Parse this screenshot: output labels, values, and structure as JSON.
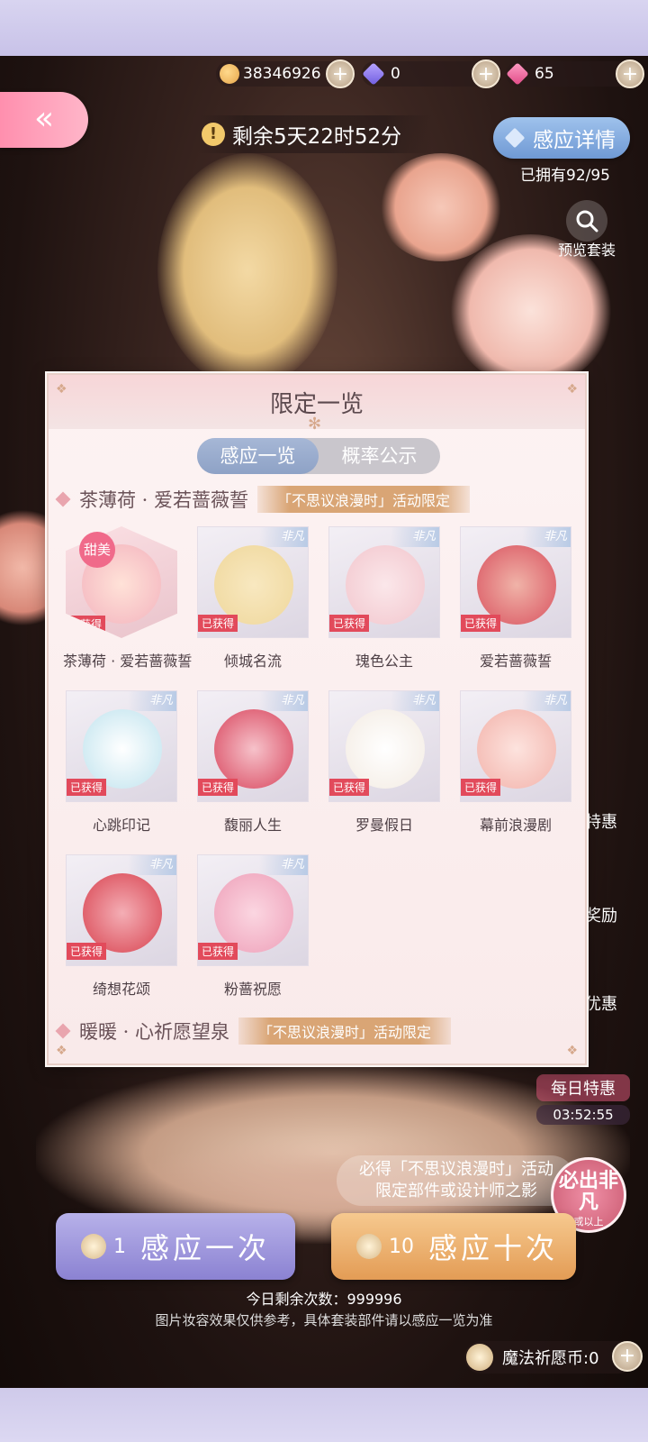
{
  "currency": {
    "coins": "38346926",
    "crystals": "0",
    "diamonds": "65",
    "coin_icon": "cat-coin-icon",
    "crystal_icon": "purple-diamond-icon",
    "diamond_icon": "pink-diamond-icon"
  },
  "back": {
    "label": "«"
  },
  "timer": {
    "text": "剩余5天22时52分"
  },
  "detail": {
    "label": "感应详情",
    "owned": "已拥有92/95"
  },
  "preview": {
    "label": "预览套装"
  },
  "side": {
    "deal": "特惠",
    "reward": "奖励",
    "benefit": "优惠"
  },
  "daily": {
    "title": "每日特惠",
    "time": "03:52:55"
  },
  "panel": {
    "title": "限定一览",
    "tabs": [
      {
        "label": "感应一览",
        "active": true
      },
      {
        "label": "概率公示",
        "active": false
      }
    ],
    "sets": [
      {
        "name": "茶薄荷 · 爱若蔷薇誓",
        "tag": "「不思议浪漫时」活动限定",
        "items": [
          {
            "name": "茶薄荷 · 爱若蔷薇誓",
            "status": "已获得",
            "badge": "甜美",
            "color": "#f3b3be"
          },
          {
            "name": "倾城名流",
            "status": "已获得",
            "ribbon": "非凡",
            "color": "#efd79b"
          },
          {
            "name": "瑰色公主",
            "status": "已获得",
            "ribbon": "非凡",
            "color": "#f2c6cd"
          },
          {
            "name": "爱若蔷薇誓",
            "status": "已获得",
            "ribbon": "非凡",
            "color": "#d9525f"
          },
          {
            "name": "心跳印记",
            "status": "已获得",
            "ribbon": "非凡",
            "color": "#bfe3ee"
          },
          {
            "name": "馥丽人生",
            "status": "已获得",
            "ribbon": "非凡",
            "color": "#d8445c"
          },
          {
            "name": "罗曼假日",
            "status": "已获得",
            "ribbon": "非凡",
            "color": "#f3ebe2"
          },
          {
            "name": "幕前浪漫剧",
            "status": "已获得",
            "ribbon": "非凡",
            "color": "#f2b2aa"
          },
          {
            "name": "绮想花颂",
            "status": "已获得",
            "ribbon": "非凡",
            "color": "#d8424f"
          },
          {
            "name": "粉蔷祝愿",
            "status": "已获得",
            "ribbon": "非凡",
            "color": "#ee9fb8"
          }
        ]
      },
      {
        "name": "暖暖 · 心祈愿望泉",
        "tag": "「不思议浪漫时」活动限定"
      }
    ]
  },
  "notice": {
    "line1": "必得「不思议浪漫时」活动",
    "line2": "限定部件或设计师之影"
  },
  "seal": {
    "big": "必出非凡",
    "small": "或以上"
  },
  "draw_one": {
    "count": "1",
    "label": "感应一次"
  },
  "draw_ten": {
    "count": "10",
    "label": "感应十次"
  },
  "remain": "今日剩余次数：999996",
  "disclaimer": "图片妆容效果仅供参考，具体套装部件请以感应一览为准",
  "magic": {
    "label": "魔法祈愿币:0"
  }
}
